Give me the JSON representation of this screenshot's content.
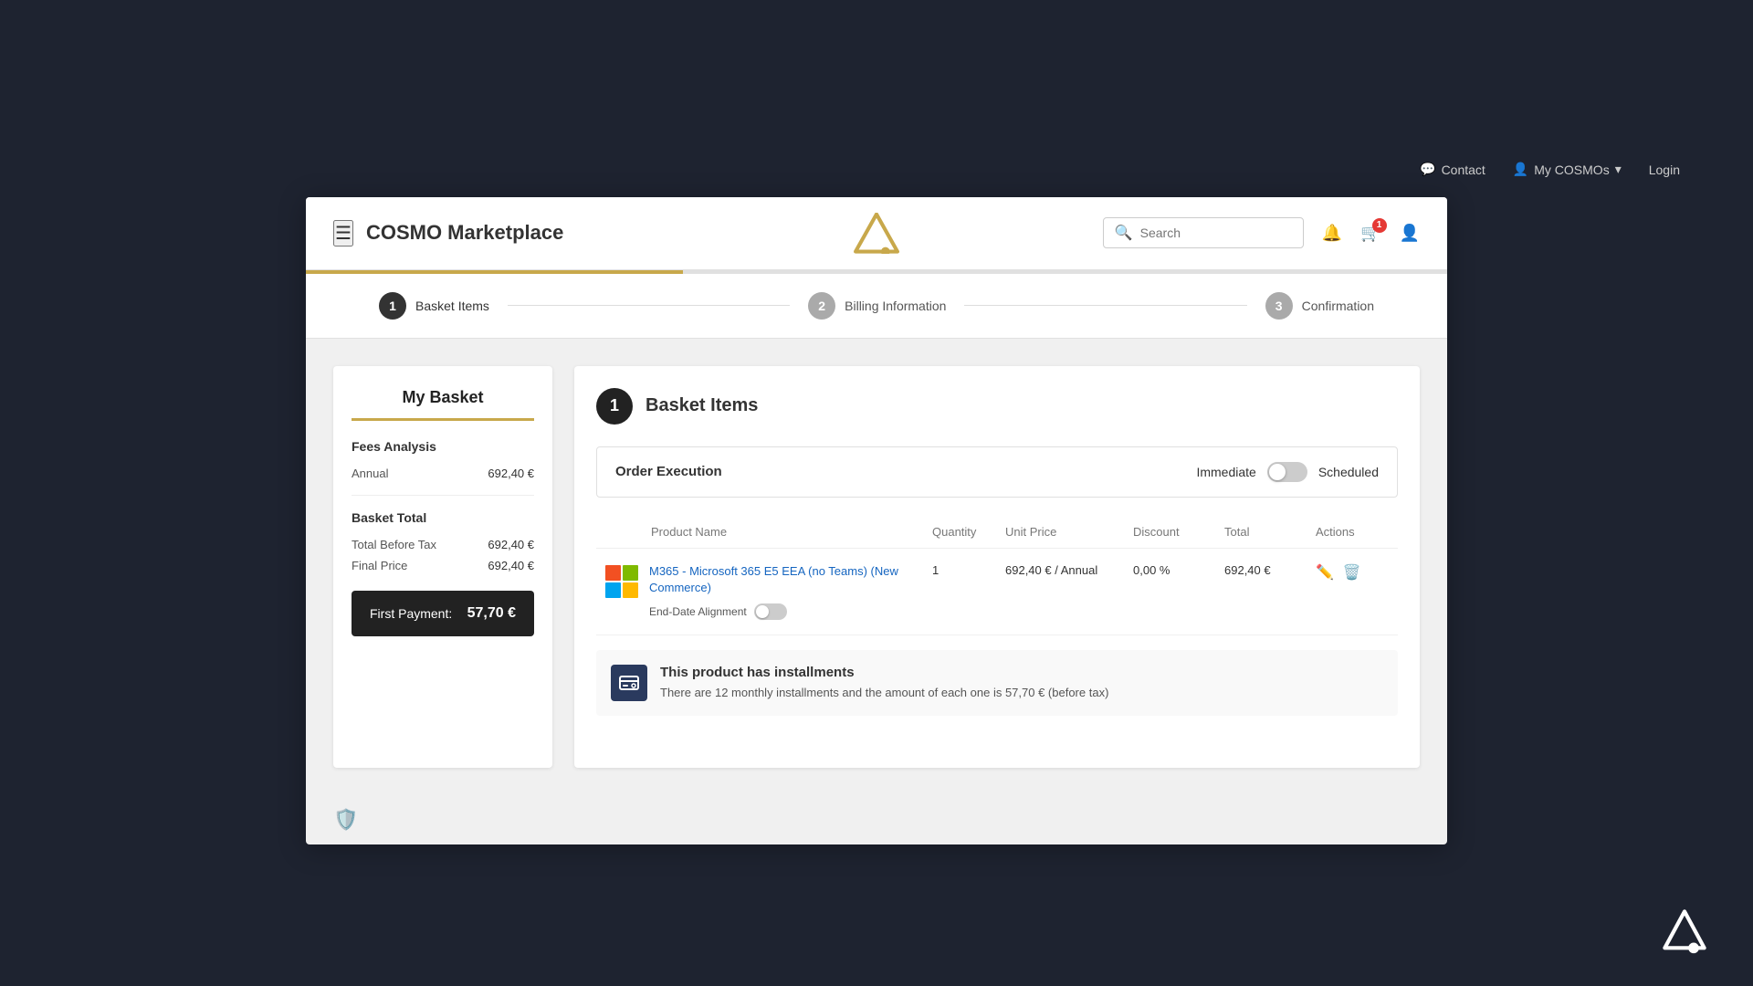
{
  "topNav": {
    "contact": "Contact",
    "myCosmos": "My COSMOs",
    "login": "Login"
  },
  "header": {
    "menuLabel": "☰",
    "logoText": "COSMO Marketplace",
    "searchPlaceholder": "Search",
    "cartBadge": "1"
  },
  "steps": [
    {
      "number": "1",
      "label": "Basket Items",
      "active": true
    },
    {
      "number": "2",
      "label": "Billing Information",
      "active": false
    },
    {
      "number": "3",
      "label": "Confirmation",
      "active": false
    }
  ],
  "sidebar": {
    "title": "My Basket",
    "feesAnalysis": "Fees Analysis",
    "annual": "Annual",
    "annualValue": "692,40 €",
    "basketTotal": "Basket Total",
    "totalBeforeTax": "Total Before Tax",
    "totalBeforeTaxValue": "692,40 €",
    "finalPrice": "Final Price",
    "finalPriceValue": "692,40 €",
    "firstPaymentLabel": "First Payment:",
    "firstPaymentValue": "57,70 €"
  },
  "main": {
    "sectionNumber": "1",
    "sectionTitle": "Basket Items",
    "orderExecution": {
      "label": "Order Execution",
      "immediate": "Immediate",
      "scheduled": "Scheduled"
    },
    "tableHeaders": {
      "productName": "Product Name",
      "quantity": "Quantity",
      "unitPrice": "Unit Price",
      "discount": "Discount",
      "total": "Total",
      "actions": "Actions"
    },
    "product": {
      "name": "M365 - Microsoft 365 E5 EEA (no Teams) (New Commerce)",
      "quantity": "1",
      "unitPrice": "692,40 € / Annual",
      "discount": "0,00 %",
      "total": "692,40 €",
      "endDateAlignment": "End-Date Alignment"
    },
    "installments": {
      "title": "This product has installments",
      "text": "There are 12 monthly installments and the amount of each one is 57,70 € (before tax)"
    }
  },
  "colors": {
    "accent": "#c8a84b",
    "dark": "#1e2330",
    "primary": "#222"
  }
}
